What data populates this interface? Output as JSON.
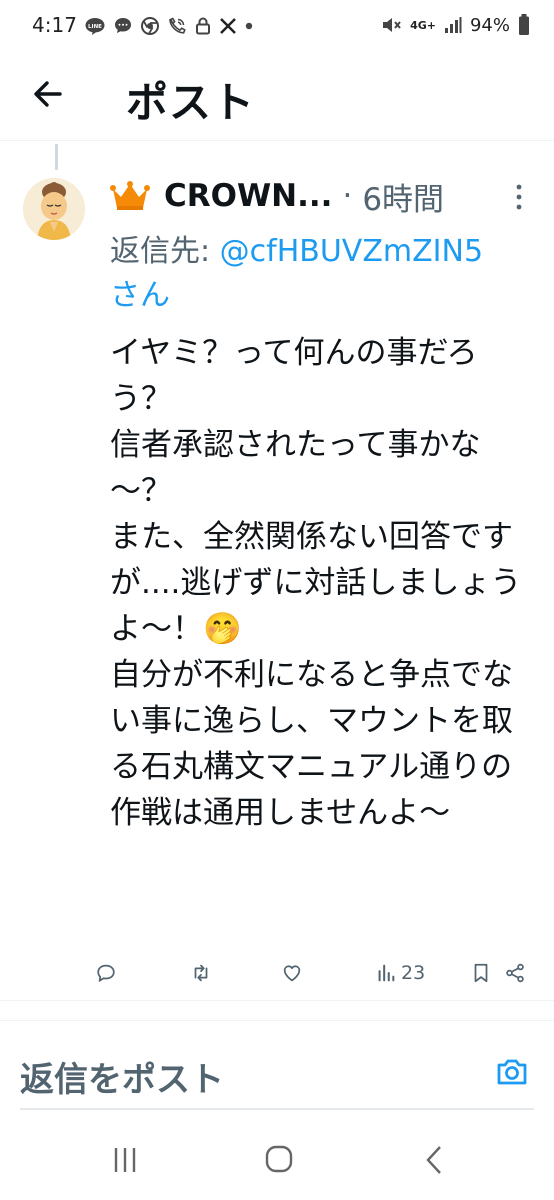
{
  "status_bar": {
    "time": "4:17",
    "battery": "94%",
    "network": "4G+"
  },
  "header": {
    "title": "ポスト"
  },
  "tweet": {
    "display_name": "CROWN...",
    "separator": "·",
    "time_ago": "6時間",
    "reply_to_label": "返信先:",
    "reply_to_handle": "@cfHBUVZmZIN5",
    "reply_to_suffix": "さん",
    "body": "イヤミ？って何んの事だろう？\n信者承認されたって事かな～？\nまた、全然関係ない回答ですが....逃げずに対話しましょうよ～！🤭\n自分が不利になると争点でない事に逸らし、マウントを取る石丸構文マニュアル通りの作戦は通用しませんよ～",
    "views": "23"
  },
  "reply_box": {
    "placeholder": "返信をポスト"
  },
  "colors": {
    "accent": "#1d9bf0",
    "text": "#0f1419",
    "secondary": "#536471",
    "crown": "#f58a07"
  },
  "icons": {
    "status_left": [
      "line-icon",
      "chat-bubble-icon",
      "chrome-icon",
      "wifi-call-icon",
      "lock-icon",
      "x-logo-icon",
      "dot-icon"
    ],
    "status_right": [
      "mute-icon",
      "signal-icon",
      "battery-icon"
    ],
    "actions": [
      "reply-icon",
      "repost-icon",
      "like-icon",
      "views-icon",
      "bookmark-icon",
      "share-icon"
    ],
    "nav": [
      "recent-apps-icon",
      "home-icon",
      "back-icon"
    ]
  }
}
